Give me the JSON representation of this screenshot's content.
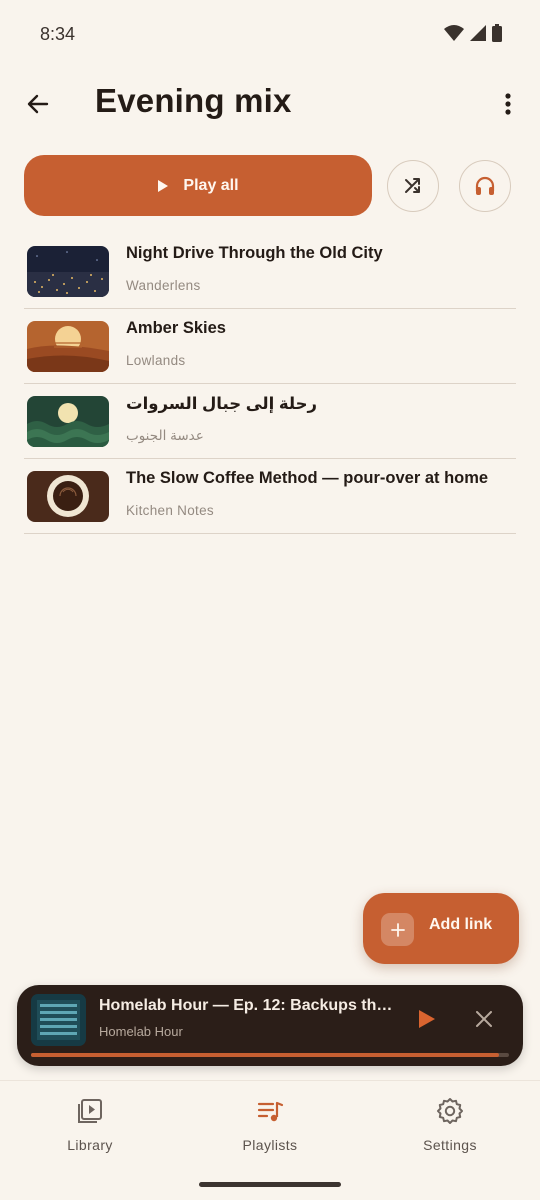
{
  "status_bar": {
    "time": "8:34"
  },
  "header": {
    "title": "Evening mix"
  },
  "actions": {
    "play_all_label": "Play all"
  },
  "tracks": [
    {
      "title": "Night Drive Through the Old City",
      "channel": "Wanderlens",
      "thumb": "city-night"
    },
    {
      "title": "Amber Skies",
      "channel": "Lowlands",
      "thumb": "sunset"
    },
    {
      "title": "رحلة إلى جبال السروات",
      "channel": "عدسة الجنوب",
      "thumb": "mountains"
    },
    {
      "title": "The Slow Coffee Method — pour-over at home",
      "channel": "Kitchen Notes",
      "thumb": "coffee"
    }
  ],
  "fab": {
    "label": "Add link"
  },
  "mini_player": {
    "title": "Homelab Hour — Ep. 12: Backups th…",
    "channel": "Homelab Hour",
    "progress": 0.98
  },
  "bottom_nav": [
    {
      "label": "Library",
      "icon": "library-icon",
      "active": false
    },
    {
      "label": "Playlists",
      "icon": "playlist-icon",
      "active": true
    },
    {
      "label": "Settings",
      "icon": "gear-icon",
      "active": false
    }
  ],
  "colors": {
    "accent": "#c65f31",
    "background": "#f9f4ed",
    "text": "#241b16",
    "secondary_text": "#948a81",
    "mini_player_bg": "#2b1e18"
  }
}
